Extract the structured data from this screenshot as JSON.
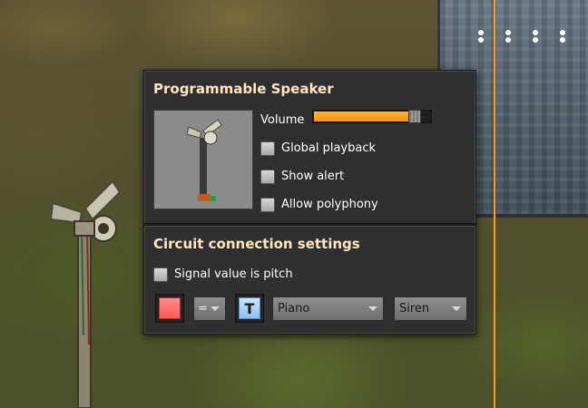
{
  "dialog": {
    "title": "Programmable Speaker",
    "volume_label": "Volume",
    "volume_level": 0.92,
    "checkboxes": [
      {
        "label": "Global playback",
        "checked": false
      },
      {
        "label": "Show alert",
        "checked": false
      },
      {
        "label": "Allow polyphony",
        "checked": false
      }
    ]
  },
  "circuit": {
    "title": "Circuit connection settings",
    "signal_checkbox": {
      "label": "Signal value is pitch",
      "checked": false
    },
    "signal_color": "#ff6b6b",
    "comparator": "=",
    "signal_button_text": "T",
    "instrument": "Piano",
    "note": "Siren"
  },
  "colors": {
    "accent": "#f7a12a",
    "title_text": "#ffe6c0",
    "panel_bg": "#2f2f2f"
  },
  "icons": {
    "preview": "programmable-speaker-icon",
    "signal": "red-signal-icon",
    "dropdown": "chevron-down-icon"
  }
}
